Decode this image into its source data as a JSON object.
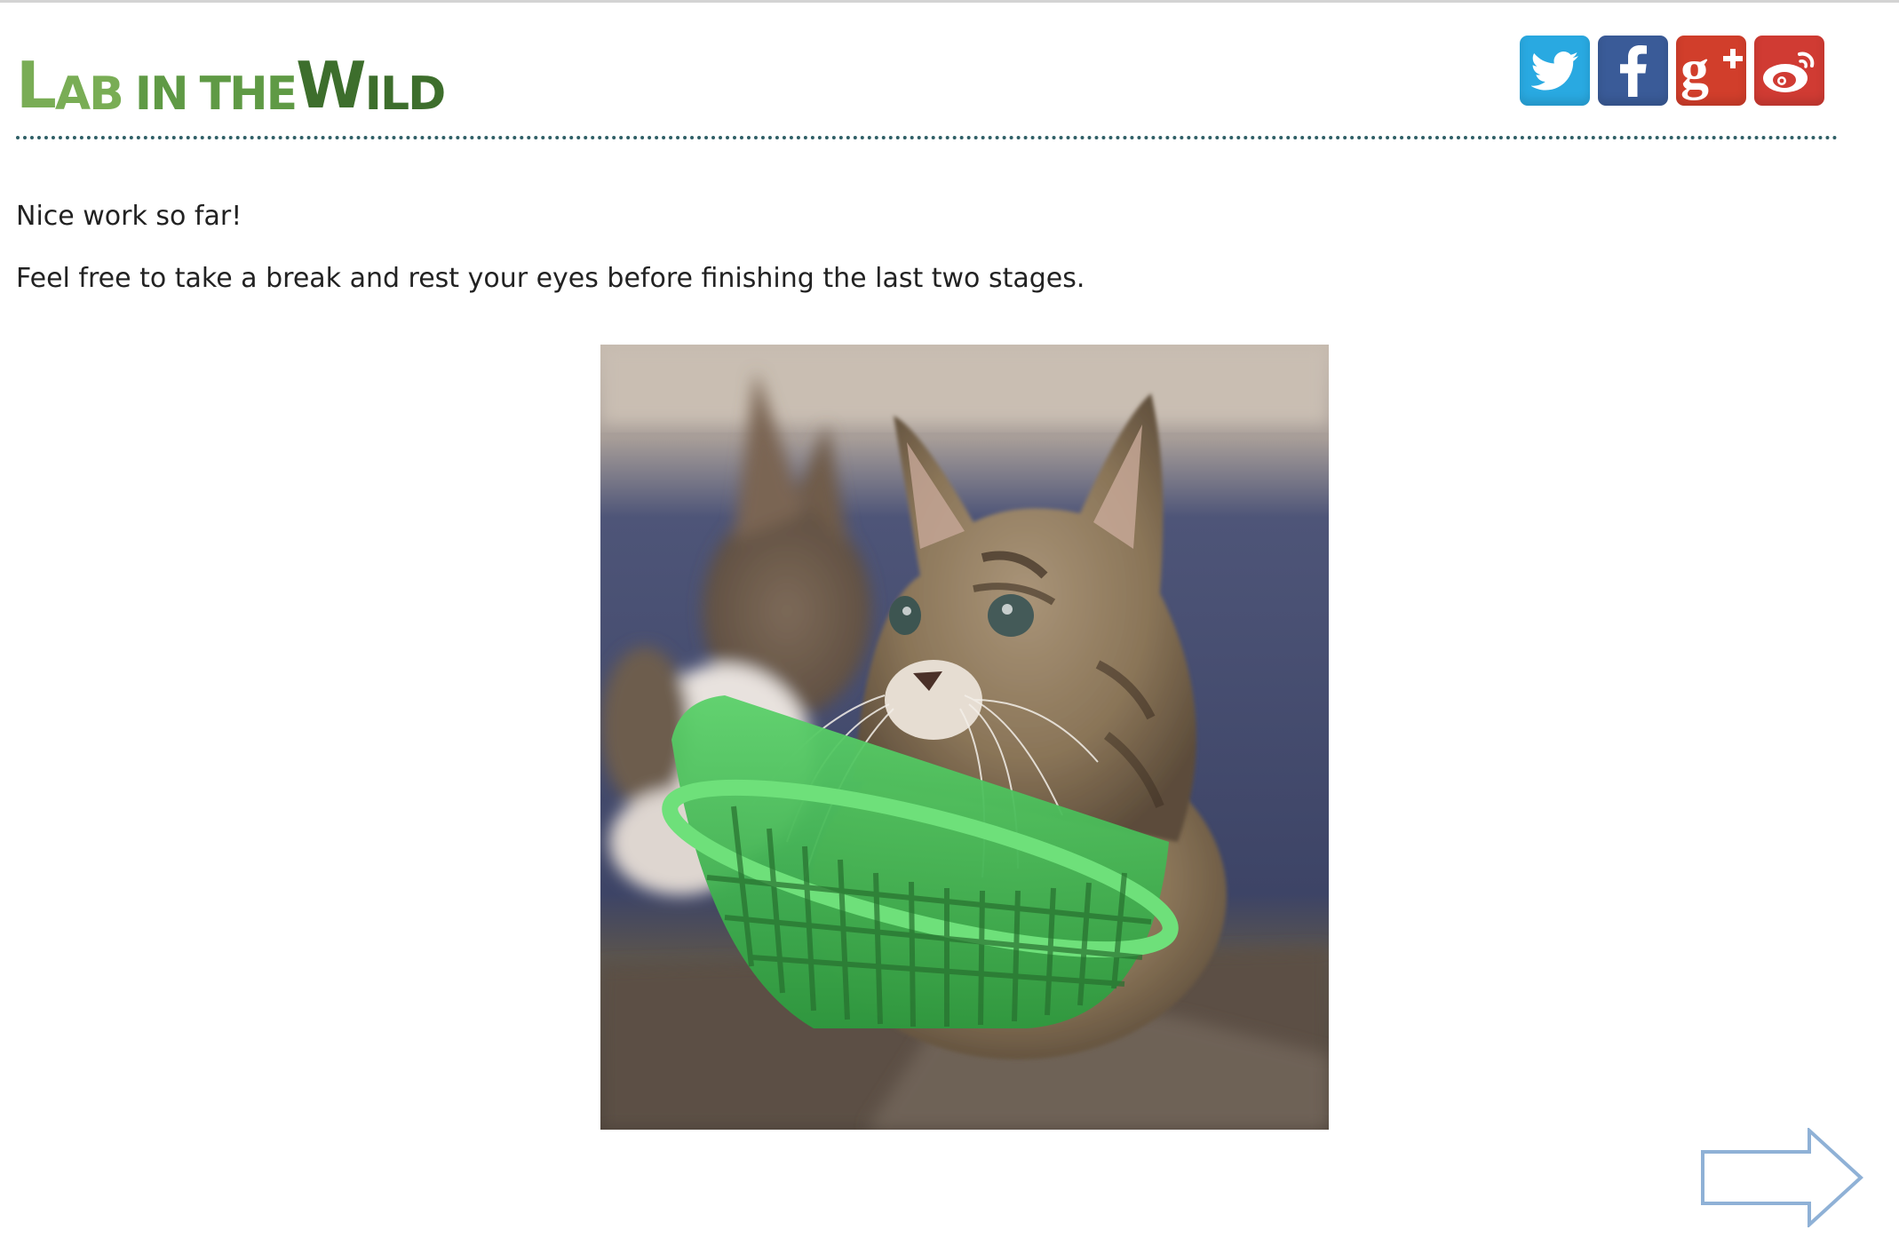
{
  "logo": {
    "part1": "Lab",
    "part2": "in",
    "part3": "the",
    "part4": "Wild"
  },
  "social": [
    {
      "name": "twitter-icon",
      "color": "#29a9e1"
    },
    {
      "name": "facebook-icon",
      "color": "#3a5b98"
    },
    {
      "name": "google-plus-icon",
      "color": "#d13e2b"
    },
    {
      "name": "weibo-icon",
      "color": "#d03b33"
    }
  ],
  "main": {
    "message1": "Nice work so far!",
    "message2": "Feel free to take a break and rest your eyes before finishing the last two stages."
  },
  "image": {
    "subject": "kittens-in-green-basket"
  },
  "navigation": {
    "next_icon": "right-arrow-icon",
    "accent": "#8fb1d6"
  }
}
